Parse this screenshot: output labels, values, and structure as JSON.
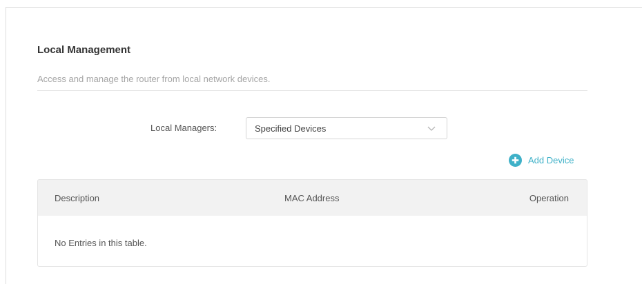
{
  "section": {
    "title": "Local Management",
    "description": "Access and manage the router from local network devices."
  },
  "local_managers": {
    "label": "Local Managers:",
    "selected": "Specified Devices"
  },
  "add_device": {
    "label": "Add Device",
    "icon": "plus-circle-icon"
  },
  "table": {
    "columns": [
      "Description",
      "MAC Address",
      "Operation"
    ],
    "empty_message": "No Entries in this table."
  },
  "colors": {
    "accent": "#3fb1c8",
    "header_bg": "#f2f2f2"
  }
}
